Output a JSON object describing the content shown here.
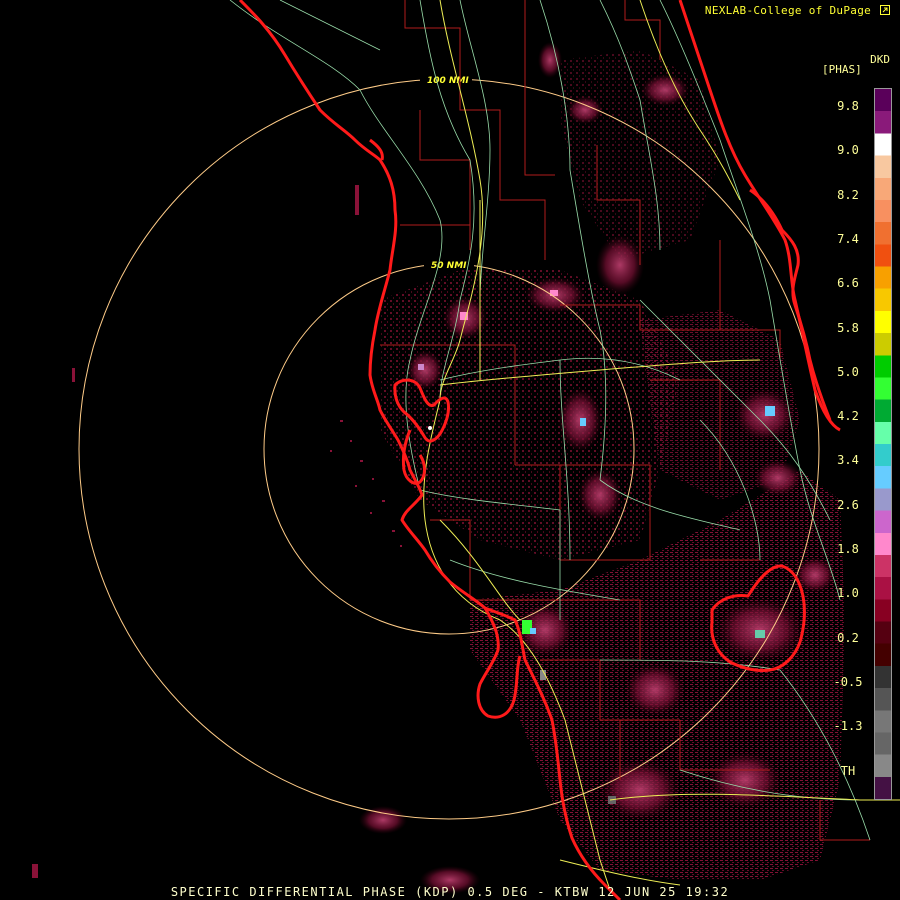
{
  "header": {
    "credit": "NEXLAB-College of DuPage"
  },
  "credit_icon": "external-link-icon",
  "colorbar": {
    "product": "DKD",
    "units": "[PHAS]",
    "ticks": [
      "9.8",
      "9.0",
      "8.2",
      "7.4",
      "6.6",
      "5.8",
      "5.0",
      "4.2",
      "3.4",
      "2.6",
      "1.8",
      "1.0",
      "0.2",
      "-0.5",
      "-1.3",
      "TH"
    ],
    "colors": [
      "#5a005a",
      "#8a1a7a",
      "#ffffff",
      "#f8c8a0",
      "#f8a878",
      "#f89060",
      "#f07030",
      "#f05010",
      "#f8a000",
      "#f8c800",
      "#ffff00",
      "#cccc00",
      "#00cc00",
      "#33ff33",
      "#00aa33",
      "#66ffaa",
      "#33cccc",
      "#66ccff",
      "#9999cc",
      "#cc66cc",
      "#ff88cc",
      "#cc3366",
      "#aa1144",
      "#880022",
      "#550011",
      "#440000",
      "#333333",
      "#555555",
      "#777777",
      "#666666",
      "#888888",
      "#441144"
    ]
  },
  "range_rings": [
    {
      "label": "50 NMI"
    },
    {
      "label": "100 NMI"
    }
  ],
  "map": {
    "coast_color": "#ff1a1a",
    "county_color": "#cc2222",
    "highway_color": "#eeee55",
    "road_color": "#99ddaa",
    "ring_color": "#ffcc88"
  },
  "footer": {
    "text": "SPECIFIC DIFFERENTIAL PHASE (KDP) 0.5 DEG - KTBW 12 JUN 25 19:32"
  }
}
